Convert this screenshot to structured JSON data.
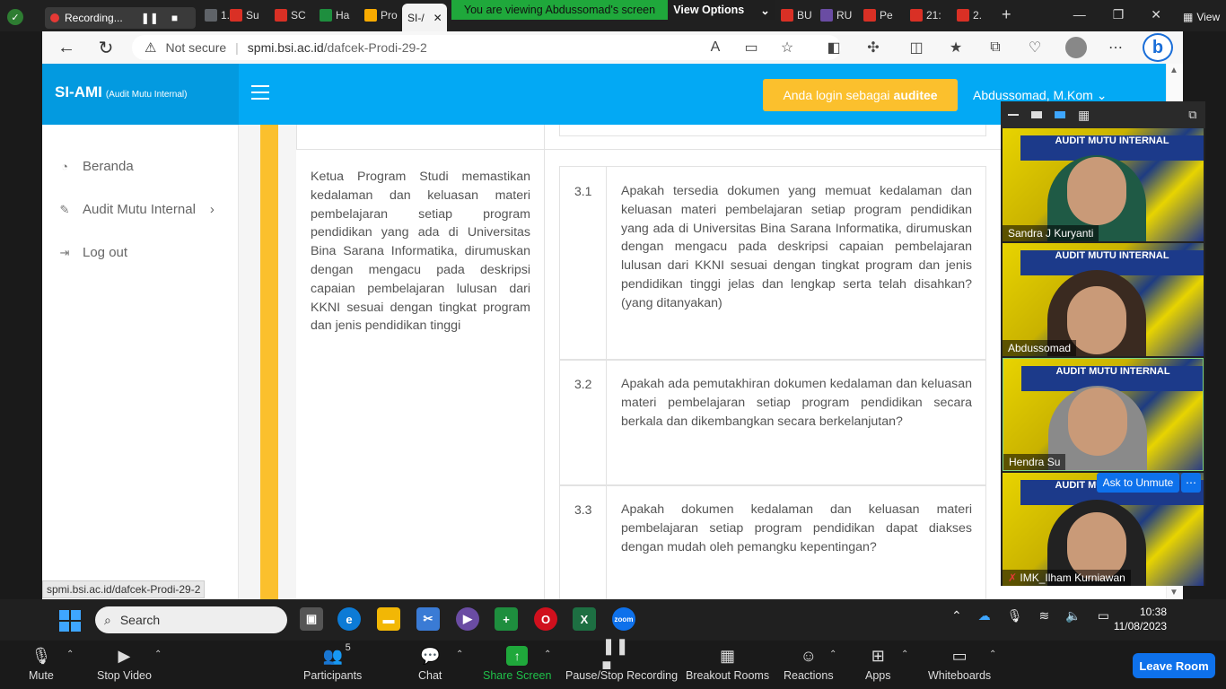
{
  "top": {
    "recording_label": "Recording...",
    "banner_text": "You are viewing Abdussomad's screen",
    "view_options": "View Options",
    "view_label": "View",
    "tabs": [
      {
        "label": "1.",
        "color": "#5f6368"
      },
      {
        "label": "Su",
        "color": "#d93025"
      },
      {
        "label": "SC",
        "color": "#d93025"
      },
      {
        "label": "Ha",
        "color": "#1e8e3e"
      },
      {
        "label": "Pro",
        "color": "#f9ab00"
      },
      {
        "label": "SI-/",
        "color": "#03a9f4"
      },
      {
        "label": "BU",
        "color": "#d93025"
      },
      {
        "label": "RU",
        "color": "#6a4ca3"
      },
      {
        "label": "Pe",
        "color": "#d93025"
      },
      {
        "label": "21:",
        "color": "#d93025"
      },
      {
        "label": "2.",
        "color": "#d93025"
      }
    ]
  },
  "browser": {
    "not_secure": "Not secure",
    "url_host": "spmi.bsi.ac.id",
    "url_path": "/dafcek-Prodi-29-2",
    "status_url": "spmi.bsi.ac.id/dafcek-Prodi-29-2"
  },
  "site": {
    "logo": "SI-AMI",
    "logo_sub": "(Audit Mutu Internal)",
    "login_prefix": "Anda login sebagai",
    "login_role": "auditee",
    "user_name": "Abdussomad, M.Kom",
    "sidebar": [
      {
        "label": "Beranda",
        "icon": "dashboard-icon"
      },
      {
        "label": "Audit Mutu Internal",
        "icon": "edit-icon"
      },
      {
        "label": "Log out",
        "icon": "logout-icon"
      }
    ],
    "requirement": "Ketua Program Studi memastikan kedalaman dan keluasan materi pembelajaran setiap program pendidikan yang ada di Universitas Bina Sarana Informatika, dirumuskan dengan mengacu pada deskripsi capaian pembelajaran lulusan dari KKNI sesuai dengan tingkat program dan jenis pendidikan tinggi",
    "questions": [
      {
        "num": "3.1",
        "text": "Apakah tersedia dokumen yang memuat kedalaman dan keluasan materi pembelajaran setiap program pendidikan yang ada di Universitas Bina Sarana Informatika, dirumuskan dengan mengacu pada deskripsi capaian pembelajaran lulusan dari KKNI sesuai dengan tingkat program dan jenis pendidikan tinggi jelas dan lengkap serta telah disahkan?(yang ditanyakan)"
      },
      {
        "num": "3.2",
        "text": "Apakah ada pemutakhiran dokumen kedalaman dan keluasan materi pembelajaran setiap program pendidikan secara berkala dan dikembangkan secara berkelanjutan?"
      },
      {
        "num": "3.3",
        "text": "Apakah dokumen kedalaman dan keluasan materi pembelajaran setiap program pendidikan dapat diakses dengan mudah oleh pemangku kepentingan?"
      }
    ]
  },
  "zoom_panel": {
    "participants": [
      "Sandra J Kuryanti",
      "Abdussomad",
      "Hendra Su",
      "IMK_Ilham Kurniawan"
    ],
    "tile_banner": "AUDIT MUTU INTERNAL",
    "ask_unmute": "Ask to Unmute"
  },
  "taskbar": {
    "search": "Search",
    "time": "10:38",
    "date": "11/08/2023"
  },
  "zoom_toolbar": {
    "mute": "Mute",
    "stop_video": "Stop Video",
    "participants": "Participants",
    "participants_count": "5",
    "chat": "Chat",
    "share_screen": "Share Screen",
    "pause_stop_recording": "Pause/Stop Recording",
    "breakout_rooms": "Breakout Rooms",
    "reactions": "Reactions",
    "apps": "Apps",
    "whiteboards": "Whiteboards",
    "leave_room": "Leave Room"
  }
}
